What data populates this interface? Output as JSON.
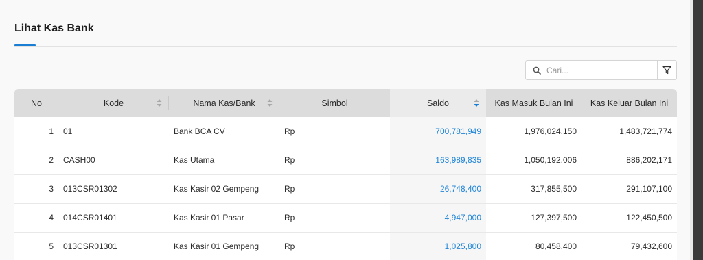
{
  "page": {
    "title": "Lihat Kas Bank"
  },
  "search": {
    "placeholder": "Cari..."
  },
  "table": {
    "columns": [
      {
        "label": "No",
        "sortable": false
      },
      {
        "label": "Kode",
        "sortable": true
      },
      {
        "label": "Nama Kas/Bank",
        "sortable": true
      },
      {
        "label": "Simbol",
        "sortable": false
      },
      {
        "label": "Saldo",
        "sortable": true,
        "sort_direction": "desc"
      },
      {
        "label": "Kas Masuk Bulan Ini",
        "sortable": false
      },
      {
        "label": "Kas Keluar Bulan Ini",
        "sortable": false
      }
    ],
    "rows": [
      {
        "no": "1",
        "kode": "01",
        "nama": "Bank BCA CV",
        "simbol": "Rp",
        "saldo": "700,781,949",
        "masuk": "1,976,024,150",
        "keluar": "1,483,721,774"
      },
      {
        "no": "2",
        "kode": "CASH00",
        "nama": "Kas Utama",
        "simbol": "Rp",
        "saldo": "163,989,835",
        "masuk": "1,050,192,006",
        "keluar": "886,202,171"
      },
      {
        "no": "3",
        "kode": "013CSR01302",
        "nama": "Kas Kasir 02 Gempeng",
        "simbol": "Rp",
        "saldo": "26,748,400",
        "masuk": "317,855,500",
        "keluar": "291,107,100"
      },
      {
        "no": "4",
        "kode": "014CSR01401",
        "nama": "Kas Kasir 01 Pasar",
        "simbol": "Rp",
        "saldo": "4,947,000",
        "masuk": "127,397,500",
        "keluar": "122,450,500"
      },
      {
        "no": "5",
        "kode": "013CSR01301",
        "nama": "Kas Kasir 01 Gempeng",
        "simbol": "Rp",
        "saldo": "1,025,800",
        "masuk": "80,458,400",
        "keluar": "79,432,600"
      }
    ]
  },
  "colors": {
    "accent": "#1a7fd4",
    "link": "#2286d8",
    "header_bg": "#dcdcdc"
  }
}
